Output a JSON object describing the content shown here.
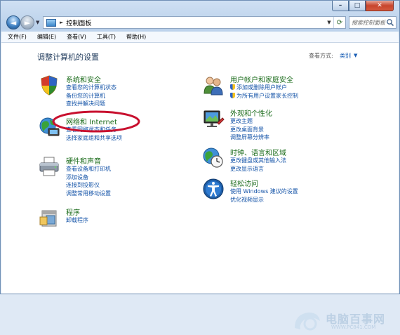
{
  "window": {
    "caption_buttons": [
      {
        "name": "minimize",
        "glyph": "–"
      },
      {
        "name": "maximize",
        "glyph": "□"
      },
      {
        "name": "close",
        "glyph": "✕"
      }
    ]
  },
  "nav": {
    "back_glyph": "◄",
    "forward_glyph": "►",
    "breadcrumb": "控制面板",
    "search_placeholder": "搜索控制面板"
  },
  "menu": [
    "文件(F)",
    "编辑(E)",
    "查看(V)",
    "工具(T)",
    "帮助(H)"
  ],
  "page": {
    "title": "调整计算机的设置",
    "view_by_label": "查看方式:",
    "view_by_value": "类别"
  },
  "categories": {
    "system": {
      "title": "系统和安全",
      "icon": "system-security-icon",
      "links": [
        "查看您的计算机状态",
        "备份您的计算机",
        "查找并解决问题"
      ]
    },
    "network": {
      "title": "网络和 Internet",
      "icon": "network-globe-icon",
      "links": [
        "查看网络状态和任务",
        "选择家庭组和共享选项"
      ]
    },
    "hardware": {
      "title": "硬件和声音",
      "icon": "printer-icon",
      "links": [
        "查看设备和打印机",
        "添加设备",
        "连接到投影仪",
        "调整常用移动设置"
      ]
    },
    "programs": {
      "title": "程序",
      "icon": "programs-icon",
      "links": [
        "卸载程序"
      ]
    },
    "users": {
      "title": "用户帐户和家庭安全",
      "icon": "users-icon",
      "links": [
        "添加或删除用户帐户",
        "为所有用户设置家长控制"
      ]
    },
    "appearance": {
      "title": "外观和个性化",
      "icon": "appearance-icon",
      "links": [
        "更改主题",
        "更改桌面背景",
        "调整屏幕分辨率"
      ]
    },
    "clock": {
      "title": "时钟、语言和区域",
      "icon": "clock-globe-icon",
      "links": [
        "更改键盘或其他输入法",
        "更改显示语言"
      ]
    },
    "ease": {
      "title": "轻松访问",
      "icon": "ease-of-access-icon",
      "links": [
        "使用 Windows 建议的设置",
        "优化视频显示"
      ]
    }
  },
  "annotation": {
    "highlight_color": "#c8102e"
  },
  "watermark": {
    "text": "电脑百事网",
    "url": "WWW.PC841.COM"
  }
}
